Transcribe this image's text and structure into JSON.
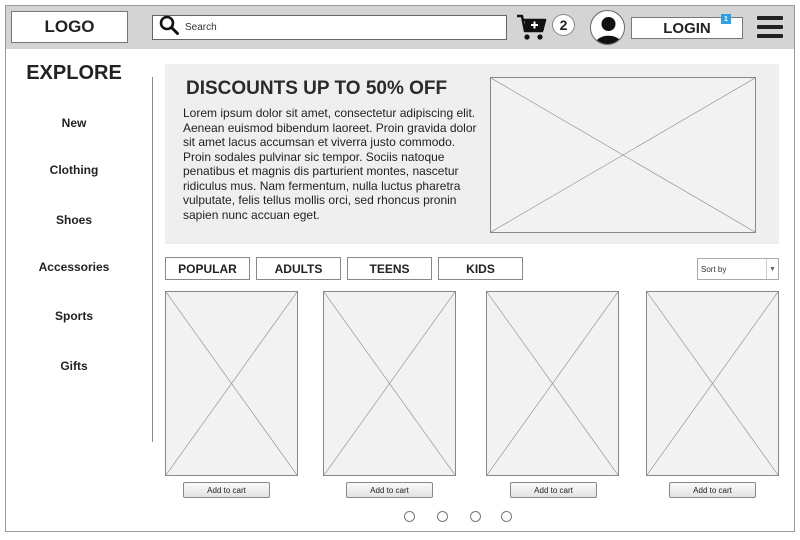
{
  "header": {
    "logo": "LOGO",
    "search_placeholder": "Search",
    "cart_count": "2",
    "login_label": "LOGIN",
    "login_badge": "1"
  },
  "sidebar": {
    "title": "EXPLORE",
    "items": [
      {
        "label": "New"
      },
      {
        "label": "Clothing"
      },
      {
        "label": "Shoes"
      },
      {
        "label": "Accessories"
      },
      {
        "label": "Sports"
      },
      {
        "label": "Gifts"
      }
    ]
  },
  "promo": {
    "title": "DISCOUNTS UP TO 50% OFF",
    "text": "Lorem ipsum dolor sit amet, consectetur adipiscing elit. Aenean euismod bibendum laoreet. Proin gravida dolor sit amet lacus accumsan et viverra justo commodo. Proin sodales pulvinar sic tempor. Sociis natoque penatibus et magnis dis parturient montes, nascetur ridiculus mus. Nam fermentum, nulla luctus pharetra vulputate, felis tellus mollis orci, sed rhoncus pronin sapien nunc accuan eget."
  },
  "tabs": [
    {
      "label": "POPULAR"
    },
    {
      "label": "ADULTS"
    },
    {
      "label": "TEENS"
    },
    {
      "label": "KIDS"
    }
  ],
  "sort": {
    "label": "Sort by"
  },
  "products": [
    {
      "button": "Add to cart"
    },
    {
      "button": "Add to cart"
    },
    {
      "button": "Add to cart"
    },
    {
      "button": "Add to cart"
    }
  ],
  "icons": {
    "search": "search-icon",
    "cart": "cart-icon",
    "avatar": "user-icon",
    "menu": "hamburger-menu-icon",
    "image_placeholder": "image-placeholder-icon"
  },
  "colors": {
    "topbar": "#d4d4d4",
    "badge": "#2e9ee6",
    "promo_bg": "#efefef"
  }
}
